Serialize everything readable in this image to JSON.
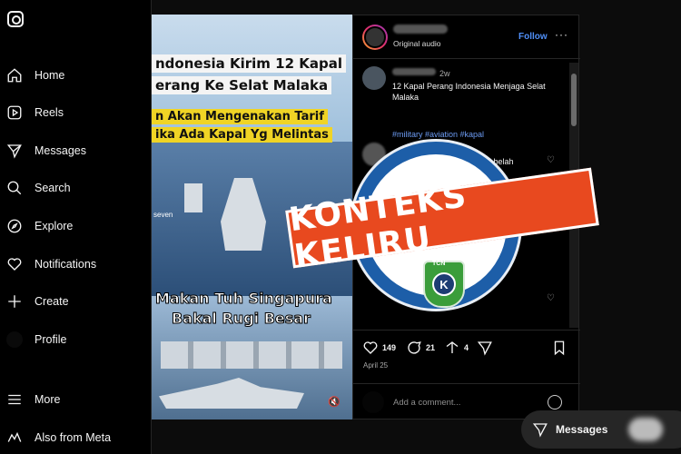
{
  "sidebar": {
    "items": [
      {
        "label": "Home",
        "icon": "home-icon"
      },
      {
        "label": "Reels",
        "icon": "reels-icon"
      },
      {
        "label": "Messages",
        "icon": "send-icon"
      },
      {
        "label": "Search",
        "icon": "search-icon"
      },
      {
        "label": "Explore",
        "icon": "compass-icon"
      },
      {
        "label": "Notifications",
        "icon": "heart-icon"
      },
      {
        "label": "Create",
        "icon": "plus-icon"
      },
      {
        "label": "Profile",
        "icon": "avatar-icon"
      },
      {
        "label": "More",
        "icon": "menu-icon"
      },
      {
        "label": "Also from Meta",
        "icon": "meta-icon"
      }
    ]
  },
  "video": {
    "caption1_line1": "ndonesia Kirim 12 Kapal",
    "caption1_line2": "erang Ke Selat Malaka",
    "caption2_line1": "n Akan Mengenakan Tarif",
    "caption2_line2": "ika Ada Kapal Yg Melintas",
    "watermark": "seven",
    "caption3_line1": "Makan Tuh Singapura",
    "caption3_line2": "Bakal Rugi Besar"
  },
  "post": {
    "audio": "Original audio",
    "follow": "Follow",
    "more": "···",
    "time": "2w",
    "caption": "12 Kapal Perang Indonesia Menjaga Selat Malaka",
    "tags": "#military #aviation #kapal",
    "comment_fragment": "i belah",
    "likes": "149",
    "comments": "21",
    "shares": "4",
    "date": "April 25",
    "comment_placeholder": "Add a comment..."
  },
  "overlay": {
    "stamp": "KONTEKS KELIRU",
    "badge_top": "TCN",
    "badge_mark": "K"
  },
  "messages_pill": {
    "label": "Messages"
  },
  "colors": {
    "stamp": "#e8491f",
    "badge_ring": "#1d5ea8",
    "link": "#4f8ff7"
  }
}
